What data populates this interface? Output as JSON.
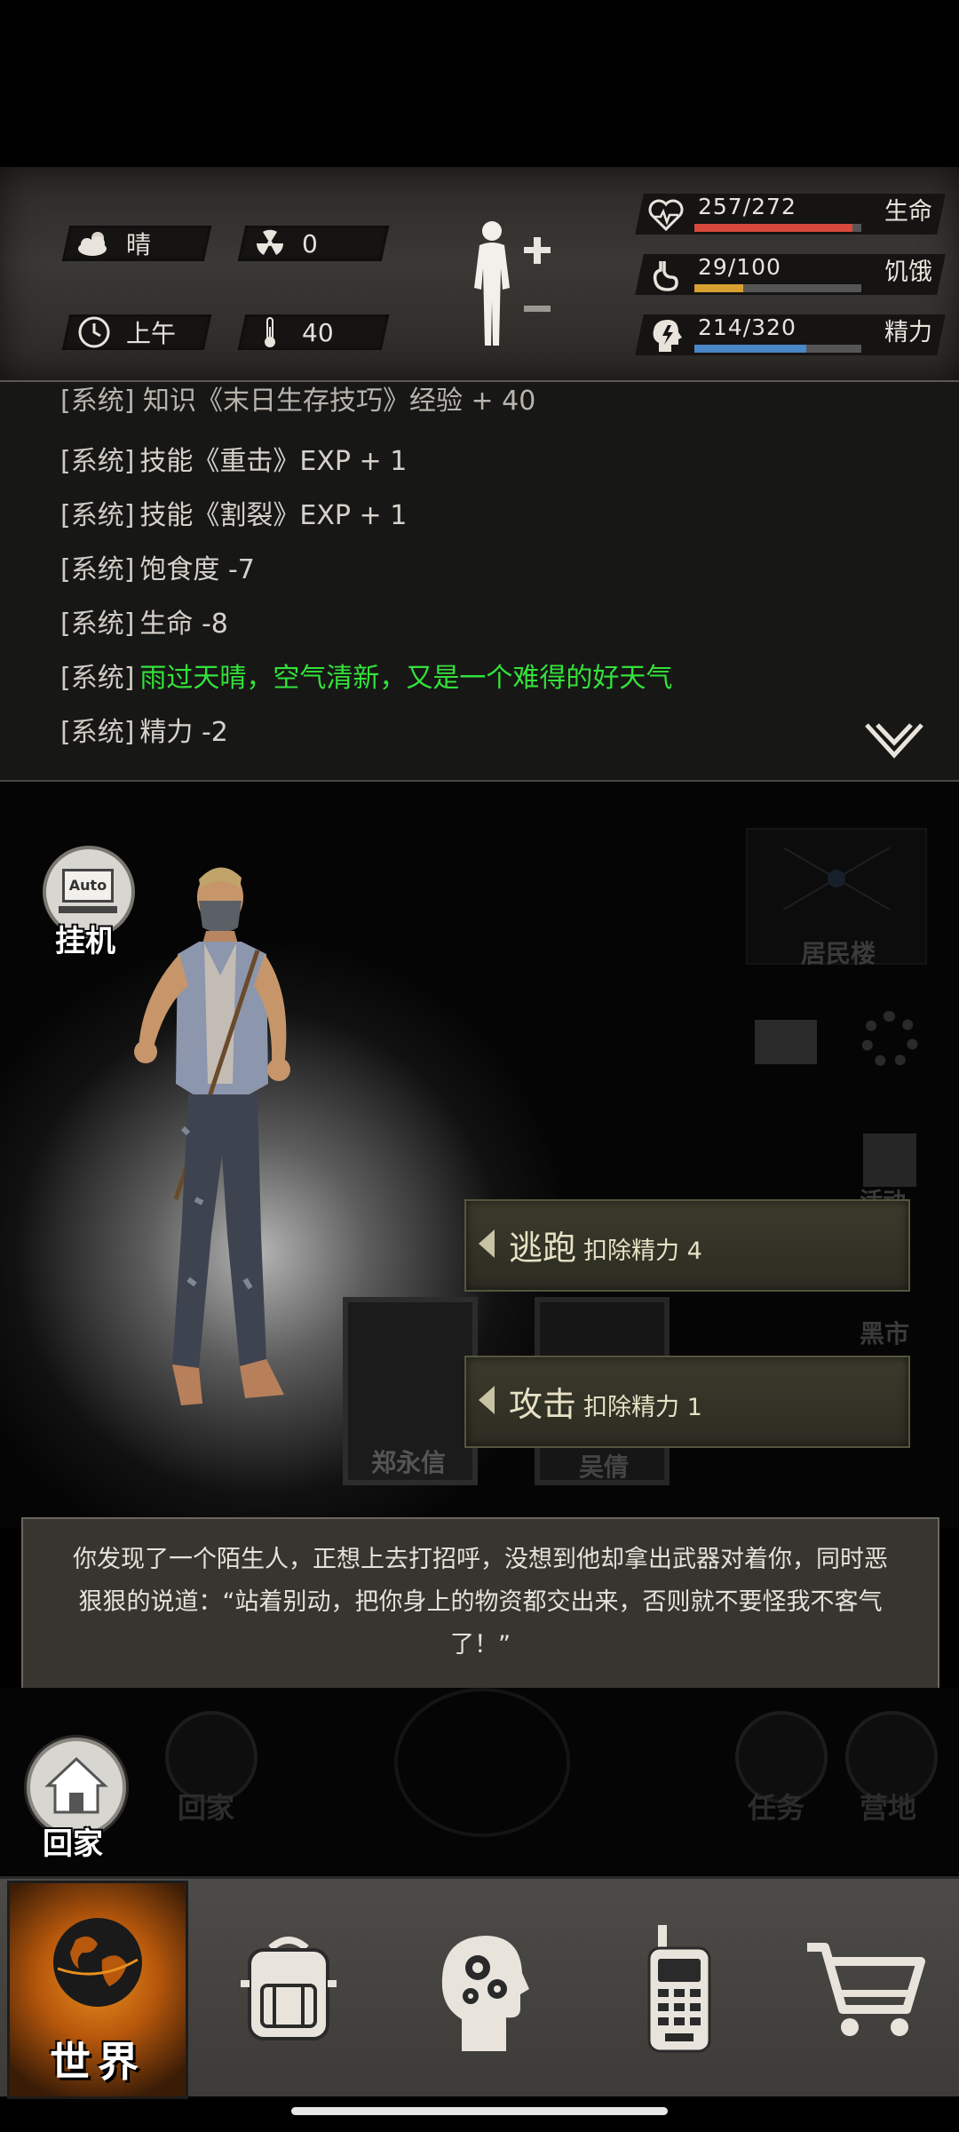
{
  "status": {
    "weather": "晴",
    "radiation": "0",
    "time_of_day": "上午",
    "temperature": "40",
    "bars": [
      {
        "name": "生命",
        "value": "257/272",
        "current": 257,
        "max": 272,
        "color": "#d8483c",
        "icon": "heart-pulse-icon"
      },
      {
        "name": "饥饿",
        "value": "29/100",
        "current": 29,
        "max": 100,
        "color": "#d8a030",
        "icon": "stomach-icon"
      },
      {
        "name": "精力",
        "value": "214/320",
        "current": 214,
        "max": 320,
        "color": "#4a86c8",
        "icon": "energy-head-icon"
      }
    ]
  },
  "log": {
    "top_partial": "[系统] 知识《末日生存技巧》经验 + 40",
    "lines": [
      {
        "tag": "[系统]",
        "msg": "技能《重击》EXP + 1"
      },
      {
        "tag": "[系统]",
        "msg": "技能《割裂》EXP + 1"
      },
      {
        "tag": "[系统]",
        "msg": "饱食度 -7"
      },
      {
        "tag": "[系统]",
        "msg": "生命 -8"
      },
      {
        "tag": "[系统]",
        "msg": "雨过天晴，空气清新，又是一个难得的好天气"
      },
      {
        "tag": "[系统]",
        "msg": "精力 -2"
      }
    ]
  },
  "scene": {
    "auto_badge": "Auto",
    "auto_label": "挂机",
    "bg_labels": {
      "residential": "居民楼",
      "black_market": "黑市",
      "event": "活动",
      "photo1": "郑永信",
      "photo2": "吴倩"
    },
    "actions": [
      {
        "title": "逃跑",
        "sub": "扣除精力 4"
      },
      {
        "title": "攻击",
        "sub": "扣除精力 1"
      }
    ],
    "dialog": "你发现了一个陌生人，正想上去打招呼，没想到他却拿出武器对着你，同时恶狠狠的说道：“站着别动，把你身上的物资都交出来，否则就不要怪我不客气了！”",
    "home_label": "回家",
    "bg_buttons": {
      "home": "回家",
      "tasks": "任务",
      "camp": "营地"
    }
  },
  "nav": {
    "world": "世界",
    "items": [
      "backpack-icon",
      "skills-head-icon",
      "radio-icon",
      "shop-cart-icon"
    ]
  }
}
